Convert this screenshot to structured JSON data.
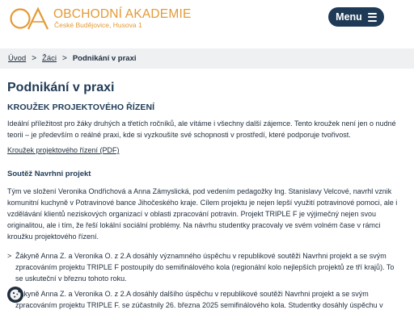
{
  "header": {
    "logo_name": "OBCHODNÍ AKADEMIE",
    "logo_sub": "České Budějovice, Husova 1",
    "logo_icon": "oa-logo-icon",
    "menu_label": "Menu",
    "menu_icon": "hamburger-icon"
  },
  "breadcrumb": {
    "items": [
      "Úvod",
      "Žáci"
    ],
    "separator": ">",
    "current": "Podnikání v praxi"
  },
  "main": {
    "title": "Podnikání v praxi",
    "section_heading": "KROUŽEK PROJEKTOVÉHO ŘÍZENÍ",
    "intro": "Ideální příležitost pro žáky druhých a třetích ročníků, ale vítáme i všechny další zájemce. Tento kroužek není jen o nudné teorii – je především o reálné praxi, kde si vyzkoušíte své schopnosti v prostředí, které podporuje tvořivost.",
    "pdf_link": "Kroužek projektového řízení (PDF)",
    "sub_heading": "Soutěž Navrhni projekt",
    "body": "Tým ve složení Veronika Ondřichová a Anna Zámyslická, pod vedením pedagožky Ing. Stanislavy Velcové, navrhl vznik komunitní kuchyně v Potravinové bance Jihočeského kraje. Cílem projektu je nejen lepší využití potravinové pomoci, ale i vzdělávání klientů neziskových organizací v oblasti zpracování potravin. Projekt TRIPLE F je výjimečný nejen svou originalitou, ale i tím, že řeší lokální sociální problémy. Na návrhu studentky pracovaly ve svém volném čase v rámci kroužku projektového řízení.",
    "bullet_marker": ">",
    "bullets": [
      "Žákyně Anna Z. a Veronika O. z 2.A dosáhly významného úspěchu v republikové soutěži Navrhni projekt a se svým zpracováním projektu TRIPLE F postoupily do semifinálového kola (regionální kolo nejlepších projektů ze tří krajů). To se uskuteční v březnu tohoto roku.",
      "Žákyně Anna Z. a Veronika O. z 2.A dosáhly dalšího úspěchu v republikové soutěži Navrhni projekt a se svým zpracováním projektu TRIPLE F. se zúčastnily 26. března 2025 semifinálového kola. Studentky dosáhly úspěchu v"
    ]
  },
  "cookie": {
    "icon": "cookie-icon"
  },
  "colors": {
    "brand_orange": "#e39a35",
    "navy": "#1f3a56",
    "text": "#1f2d3d",
    "breadcrumb_bg": "#eef0f2"
  }
}
